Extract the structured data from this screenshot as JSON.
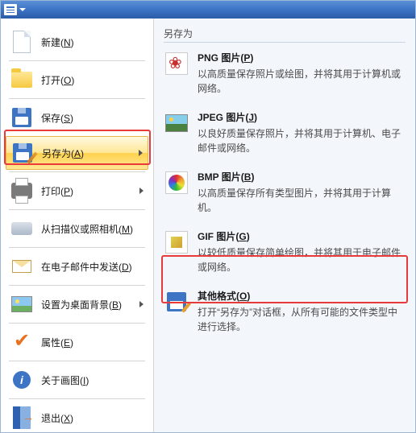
{
  "left_menu": {
    "new": "新建(N)",
    "open": "打开(O)",
    "save": "保存(S)",
    "save_as": "另存为(A)",
    "print": "打印(P)",
    "scanner": "从扫描仪或照相机(M)",
    "email": "在电子邮件中发送(D)",
    "wallpaper": "设置为桌面背景(B)",
    "properties": "属性(E)",
    "about": "关于画图(I)",
    "exit": "退出(X)"
  },
  "right_panel": {
    "title": "另存为",
    "png_title": "PNG 图片(P)",
    "png_desc": "以高质量保存照片或绘图，并将其用于计算机或网络。",
    "jpeg_title": "JPEG 图片(J)",
    "jpeg_desc": "以良好质量保存照片，并将其用于计算机、电子邮件或网络。",
    "bmp_title": "BMP 图片(B)",
    "bmp_desc": "以高质量保存所有类型图片，并将其用于计算机。",
    "gif_title": "GIF 图片(G)",
    "gif_desc": "以较低质量保存简单绘图，并将其用于电子邮件或网络。",
    "other_title": "其他格式(O)",
    "other_desc": "打开“另存为”对话框，从所有可能的文件类型中进行选择。"
  }
}
